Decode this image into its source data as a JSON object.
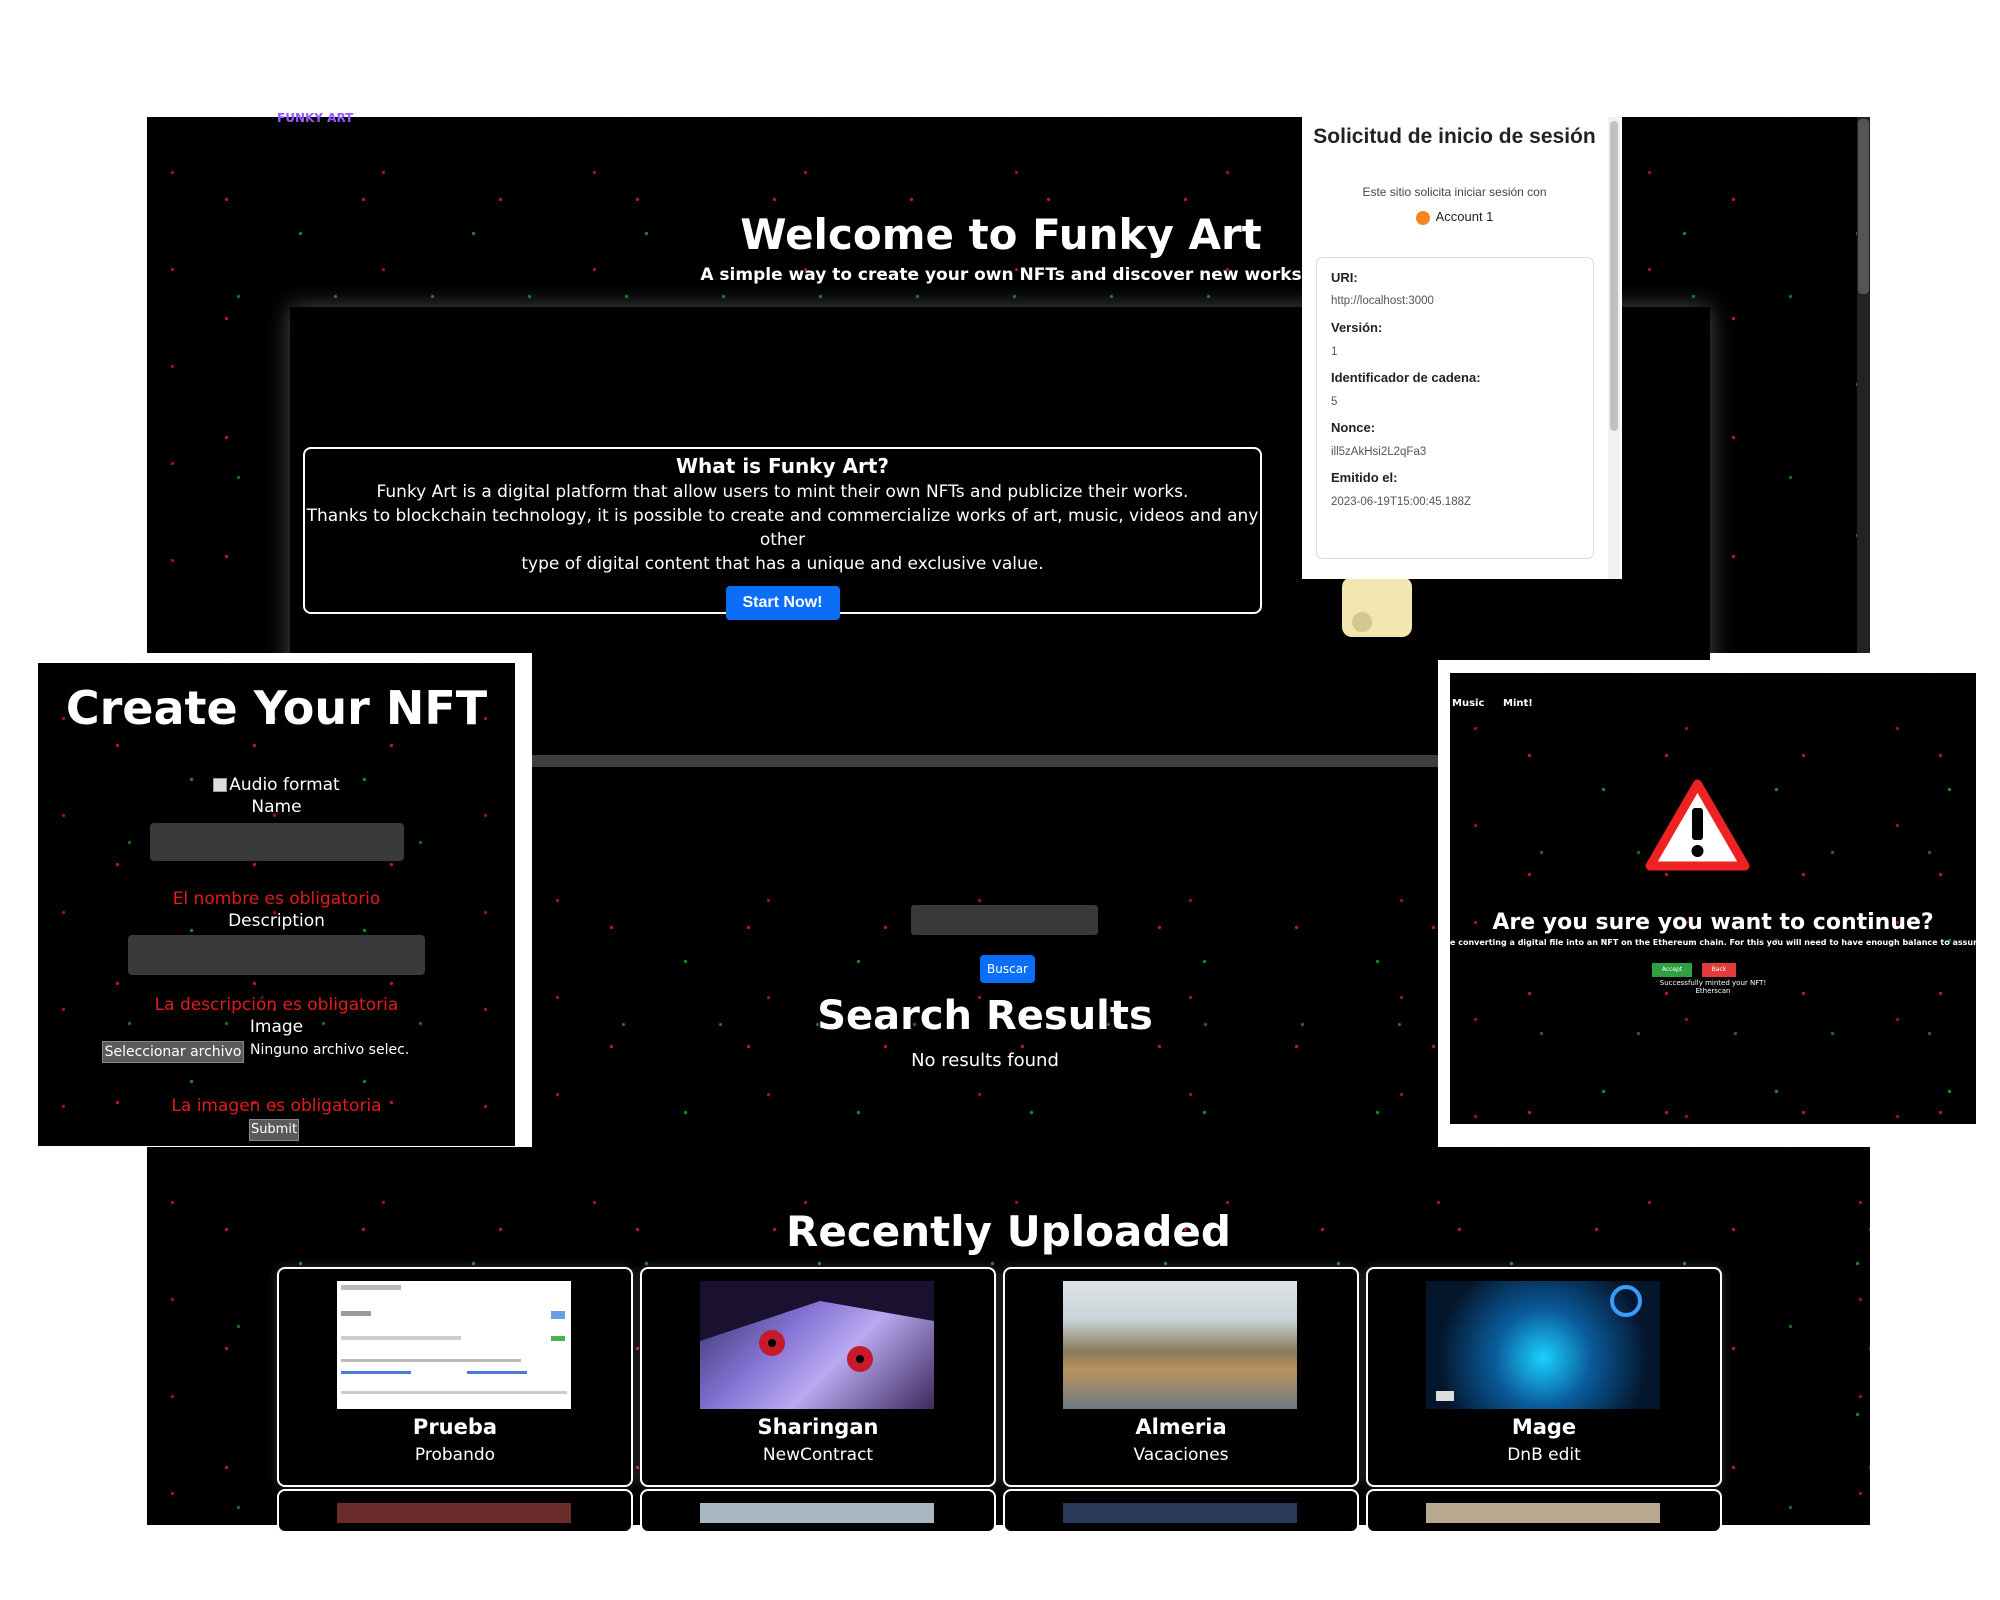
{
  "home": {
    "logo": "FUNKY ART",
    "title": "Welcome to Funky Art",
    "subtitle": "A simple way to create your own NFTs and discover new works",
    "what_title": "What is Funky Art?",
    "what_line1": "Funky Art is a digital platform that allow users to mint their own NFTs and publicize their works.",
    "what_line2": "Thanks to blockchain technology, it is possible to create and commercialize works of art, music, videos and any other",
    "what_line3": "type of digital content that has a unique and exclusive value.",
    "start_button": "Start Now!"
  },
  "metamask": {
    "title": "Solicitud de inicio de sesión",
    "description": "Este sitio solicita iniciar sesión con",
    "account": "Account 1",
    "uri_label": "URI:",
    "uri_value": "http://localhost:3000",
    "version_label": "Versión:",
    "version_value": "1",
    "chain_label": "Identificador de cadena:",
    "chain_value": "5",
    "nonce_label": "Nonce:",
    "nonce_value": "ill5zAkHsi2L2qFa3",
    "issued_label": "Emitido el:",
    "issued_value": "2023-06-19T15:00:45.188Z"
  },
  "create": {
    "title": "Create Your NFT",
    "audio_label": "Audio format",
    "name_label": "Name",
    "name_error": "El nombre es obligatorio",
    "description_label": "Description",
    "description_error": "La descripción es obligatoria",
    "image_label": "Image",
    "file_button": "Seleccionar archivo",
    "file_status": "Ninguno archivo selec.",
    "image_error": "La imagen es obligatoria",
    "submit_button": "Submit"
  },
  "search": {
    "button": "Buscar",
    "title": "Search Results",
    "empty": "No results found"
  },
  "confirm": {
    "nav_music": "Music",
    "nav_mint": "Mint!",
    "question": "Are you sure you want to continue?",
    "text": "e converting a digital file into an NFT on the Ethereum chain. For this you will need to have enough balance to assume th",
    "accept": "Accept",
    "back": "Back",
    "minted": "Successfully minted your NFT!",
    "etherscan": "Etherscan"
  },
  "recent": {
    "title": "Recently Uploaded",
    "cards": [
      {
        "name": "Prueba",
        "description": "Probando"
      },
      {
        "name": "Sharingan",
        "description": "NewContract"
      },
      {
        "name": "Almeria",
        "description": "Vacaciones"
      },
      {
        "name": "Mage",
        "description": "DnB edit"
      }
    ]
  },
  "colors": {
    "accent_blue": "#0b6ef9",
    "error_red": "#e31b1b",
    "accept_green": "#2ea043",
    "back_red": "#e23b3b"
  },
  "icons": [
    "warning-icon",
    "metamask-fox-icon"
  ]
}
